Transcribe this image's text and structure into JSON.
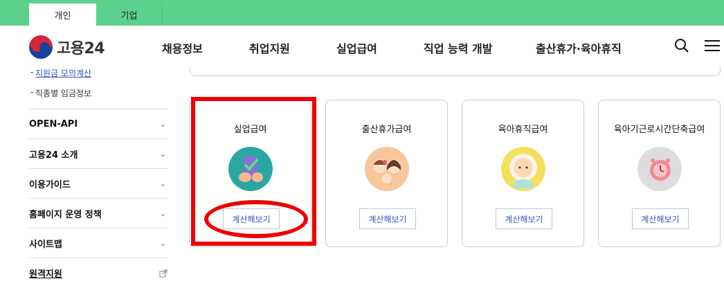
{
  "topbar": {
    "tabs": [
      {
        "label": "개인"
      },
      {
        "label": "기업"
      }
    ]
  },
  "header": {
    "logo_text": "고용24",
    "nav": [
      {
        "label": "채용정보"
      },
      {
        "label": "취업지원"
      },
      {
        "label": "실업급여"
      },
      {
        "label": "직업 능력 개발"
      },
      {
        "label": "출산휴가·육아휴직"
      }
    ]
  },
  "sidebar": {
    "sublinks": [
      {
        "label": "지원금 모의계산",
        "prefix": "-"
      },
      {
        "label": "직종별 임금정보",
        "prefix": "-"
      }
    ],
    "items": [
      {
        "label": "OPEN-API"
      },
      {
        "label": "고용24 소개"
      },
      {
        "label": "이용가이드"
      },
      {
        "label": "홈페이지 운영 정책"
      },
      {
        "label": "사이트맵"
      },
      {
        "label": "원격지원"
      }
    ],
    "chevron": "⌄"
  },
  "cards": [
    {
      "title": "실업급여",
      "button": "계산해보기",
      "icon_bg": "#2aa6a3"
    },
    {
      "title": "출산휴가급여",
      "button": "계산해보기",
      "icon_bg": "#f7c79b"
    },
    {
      "title": "육아휴직급여",
      "button": "계산해보기",
      "icon_bg": "#f3e15c"
    },
    {
      "title": "육아기근로시간단축급여",
      "button": "계산해보기",
      "icon_bg": "#dddddd"
    }
  ],
  "colors": {
    "topbar": "#5cd18e",
    "highlight": "#ee0000",
    "button_text": "#3654b8"
  }
}
